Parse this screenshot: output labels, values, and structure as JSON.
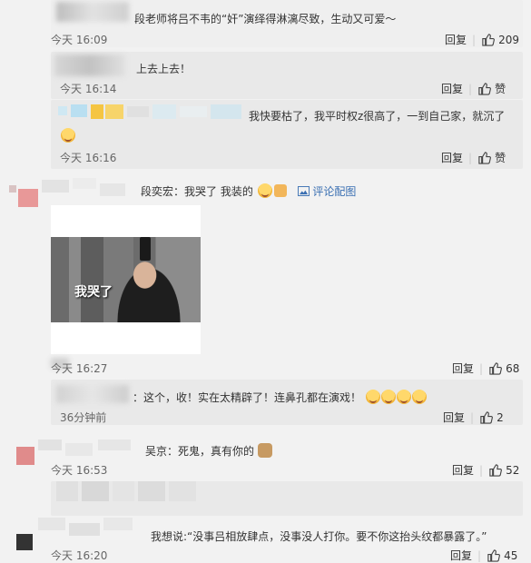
{
  "comments": [
    {
      "text": "段老师将吕不韦的“奸”演绎得淋漓尽致，生动又可爱～",
      "time": "今天 16:09",
      "reply": "回复",
      "likes": "209"
    },
    {
      "text": "上去上去！",
      "time": "今天 16:14",
      "reply": "回复",
      "likes": "赞"
    },
    {
      "text": "我快要枯了，我平时权z很高了，一到自己家，就沉了",
      "time": "今天 16:16",
      "reply": "回复",
      "likes": "赞"
    },
    {
      "author": "段奕宏",
      "sep": "：",
      "text": "我哭了 我装的",
      "link": "评论配图",
      "image_caption": "我哭了",
      "time": "今天 16:27",
      "reply": "回复",
      "likes": "68"
    },
    {
      "text": "：这个，收！实在太精辟了！连鼻孔都在演戏！",
      "time": "36分钟前",
      "reply": "回复",
      "likes": "2"
    },
    {
      "author": "吴京",
      "sep": "：",
      "text": "死鬼，真有你的",
      "time": "今天 16:53",
      "reply": "回复",
      "likes": "52"
    },
    {
      "text": "我想说:“没事吕相放肆点，没事没人打你。要不你这抬头纹都暴露了。”",
      "time": "今天 16:20",
      "reply": "回复",
      "likes": "45"
    }
  ],
  "colors": {
    "link": "#3a6fb2",
    "background": "#f2f2f2",
    "sub_background": "#e9e9e9"
  },
  "icons": [
    "thumbs-up-icon",
    "image-icon",
    "emoji-icon"
  ]
}
